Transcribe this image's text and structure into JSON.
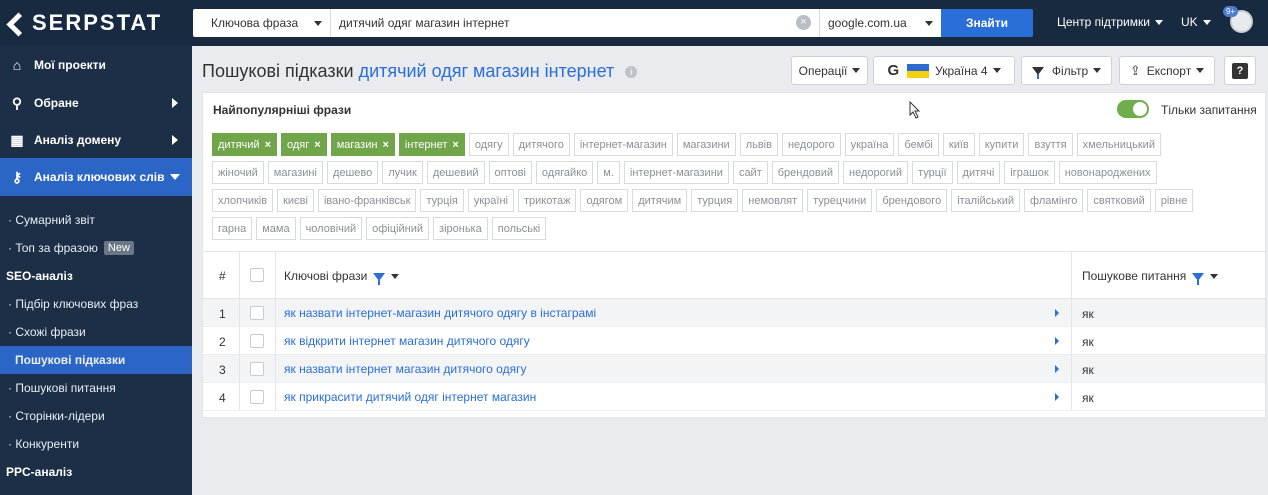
{
  "topbar": {
    "logo_text": "SERPSTAT",
    "query_type": "Ключова фраза",
    "query": "дитячий одяг магазин інтернет",
    "engine": "google.com.ua",
    "search_button": "Знайти",
    "support": "Центр підтримки",
    "language": "UK",
    "avatar_badge": "9+"
  },
  "sidebar": {
    "main_items": [
      {
        "label": "Мої проекти",
        "icon": "home-icon"
      },
      {
        "label": "Обране",
        "icon": "pin-icon"
      },
      {
        "label": "Аналіз домену",
        "icon": "chart-icon"
      },
      {
        "label": "Аналіз ключових слів",
        "icon": "key-icon"
      }
    ],
    "sub_items": [
      {
        "label": "Сумарний звіт"
      },
      {
        "label": "Топ за фразою",
        "badge": "New"
      }
    ],
    "section_seo": "SEO-аналіз",
    "seo_items": [
      {
        "label": "Підбір ключових фраз"
      },
      {
        "label": "Схожі фрази"
      },
      {
        "label": "Пошукові підказки"
      },
      {
        "label": "Пошукові питання"
      },
      {
        "label": "Сторінки-лідери"
      },
      {
        "label": "Конкуренти"
      }
    ],
    "section_ppc": "PPC-аналіз"
  },
  "header": {
    "title_prefix": "Пошукові підказки",
    "title_query": "дитячий одяг магазин інтернет",
    "operations": "Операції",
    "region": "Україна 4",
    "filter": "Фільтр",
    "export": "Експорт",
    "help": "?"
  },
  "panel": {
    "popular_label": "Найпопулярніші фрази",
    "questions_only": "Тільки запитання",
    "questions_only_on": true
  },
  "tags": {
    "selected": [
      "дитячий",
      "одяг",
      "магазин",
      "інтернет"
    ],
    "row1": [
      "одягу",
      "дитячого",
      "інтернет-магазин",
      "магазини",
      "львів",
      "недорого",
      "україна",
      "бембі",
      "київ",
      "купити",
      "взуття",
      "хмельницький"
    ],
    "row2": [
      "жіночий",
      "магазині",
      "дешево",
      "лучик",
      "дешевий",
      "оптові",
      "одягайко",
      "м.",
      "інтернет-магазини",
      "сайт",
      "брендовий",
      "недорогий",
      "турції",
      "дитячі",
      "іграшок",
      "новонароджених"
    ],
    "row3": [
      "хлопчиків",
      "києві",
      "івано-франківськ",
      "турція",
      "україні",
      "трикотаж",
      "одягом",
      "дитячим",
      "турция",
      "немовлят",
      "турецчини",
      "брендового",
      "італійський",
      "фламінго",
      "святковий",
      "рівне"
    ],
    "row4": [
      "гарна",
      "мама",
      "чоловічий",
      "офіційний",
      "зіронька",
      "польські"
    ]
  },
  "table": {
    "col_num": "#",
    "col_keywords": "Ключові фрази",
    "col_question": "Пошукове питання",
    "rows": [
      {
        "num": "1",
        "keyword": "як назвати інтернет-магазин дитячого одягу в інстаграмі",
        "question": "як"
      },
      {
        "num": "2",
        "keyword": "як відкрити інтернет магазин дитячого одягу",
        "question": "як"
      },
      {
        "num": "3",
        "keyword": "як назвати інтернет магазин дитячого одягу",
        "question": "як"
      },
      {
        "num": "4",
        "keyword": "як прикрасити дитячий одяг інтернет магазин",
        "question": "як"
      }
    ]
  },
  "colors": {
    "topbar": "#172a3f",
    "sidebar": "#1c2f46",
    "accent": "#2b66c6",
    "tag_selected": "#70a54a"
  }
}
